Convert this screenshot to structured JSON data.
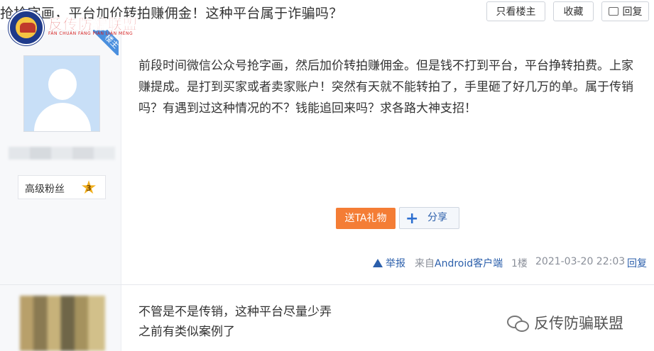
{
  "header": {
    "thread_title": "抢抢字画，平台加价转拍赚佣金！这种平台属于诈骗吗？",
    "only_op_label": "只看楼主",
    "favorite_label": "收藏",
    "reply_label": "回复"
  },
  "logo": {
    "text": "反传防骗联盟",
    "subtext": "FĀN CHUÁN FÁNG PIÀN LIÁN MÉNG"
  },
  "op_post": {
    "badge": "楼主",
    "user_rank": "高级粉丝",
    "user_level": "3",
    "content": "前段时间微信公众号抢字画，然后加价转拍赚佣金。但是钱不打到平台，平台挣转拍费。上家赚提成。是打到买家或者卖家账户！突然有天就不能转拍了，手里砸了好几万的单。属于传销吗？有遇到过这种情况的不？钱能追回来吗？求各路大神支招！",
    "gift_button": "送TA礼物",
    "share_button": "分享",
    "report_label": "举报",
    "source_prefix": "来自",
    "source_client": "Android客户端",
    "floor": "1楼",
    "time": "2021-03-20 22:03",
    "reply_label": "回复"
  },
  "reply_post": {
    "lines": [
      "不管是不是传销，这种平台尽量少弄",
      "之前有类似案例了"
    ]
  },
  "watermark": {
    "text": "反传防骗联盟"
  },
  "colors": {
    "accent_blue": "#2b5fab",
    "gift_orange": "#f47d35",
    "logo_red": "#d62222",
    "ribbon_blue": "#4a8fde"
  }
}
